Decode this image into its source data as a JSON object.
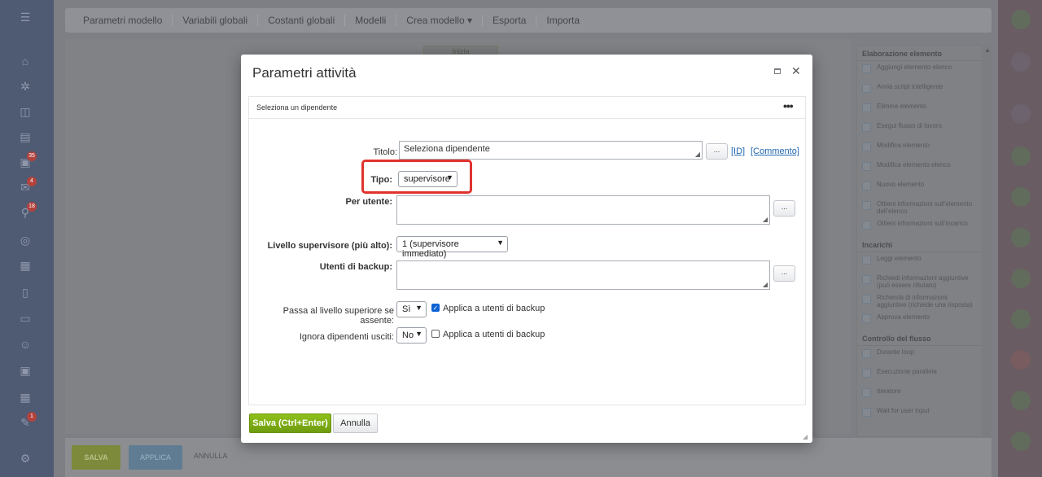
{
  "topnav": {
    "items": [
      "Parametri modello",
      "Variabili globali",
      "Costanti globali",
      "Modelli",
      "Crea modello ▾",
      "Esporta",
      "Importa"
    ]
  },
  "canvas": {
    "node_label": "Inizia"
  },
  "right_panel": {
    "sections": [
      {
        "title": "Elaborazione elemento",
        "items": [
          "Aggiungi elemento elenco",
          "Avvia script intelligente",
          "Elimina elemento",
          "Esegui flusso di lavoro",
          "Modifica elemento",
          "Modifica elemento elenco",
          "Nuovo elemento",
          "Ottieni informazioni sull'elemento dell'elenco",
          "Ottieni informazioni sull'incarico"
        ]
      },
      {
        "title": "Incarichi",
        "items": [
          "Leggi elemento",
          "Richiedi informazioni aggiuntive (può essere rifiutato)",
          "Richiesta di informazioni aggiuntive (richiede una risposta)",
          "Approva elemento"
        ]
      },
      {
        "title": "Controllo del flusso",
        "items": [
          "Durante loop",
          "Esecuzione parallela",
          "Iteratore",
          "Wait for user input"
        ]
      }
    ]
  },
  "bottombar": {
    "save": "SALVA",
    "apply": "APPLICA",
    "cancel": "ANNULLA"
  },
  "sidebar": {
    "badges": [
      "35",
      "4",
      "18",
      "1"
    ]
  },
  "modal": {
    "title": "Parametri attività",
    "subheader": "Seleziona un dipendente",
    "fields": {
      "titolo_label": "Titolo:",
      "titolo_value": "Seleziona dipendente",
      "id_link": "[ID]",
      "comment_link": "[Commento]",
      "tipo_label": "Tipo:",
      "tipo_value": "supervisore",
      "per_utente_label": "Per utente:",
      "livello_label": "Livello supervisore (più alto):",
      "livello_value": "1 (supervisore immediato)",
      "backup_label": "Utenti di backup:",
      "passa_label": "Passa al livello superiore se assente:",
      "passa_value": "Sì",
      "passa_chk_label": "Applica a utenti di backup",
      "ignora_label": "Ignora dipendenti usciti:",
      "ignora_value": "No",
      "ignora_chk_label": "Applica a utenti di backup",
      "dots": "..."
    },
    "buttons": {
      "save": "Salva (Ctrl+Enter)",
      "cancel": "Annulla"
    }
  }
}
